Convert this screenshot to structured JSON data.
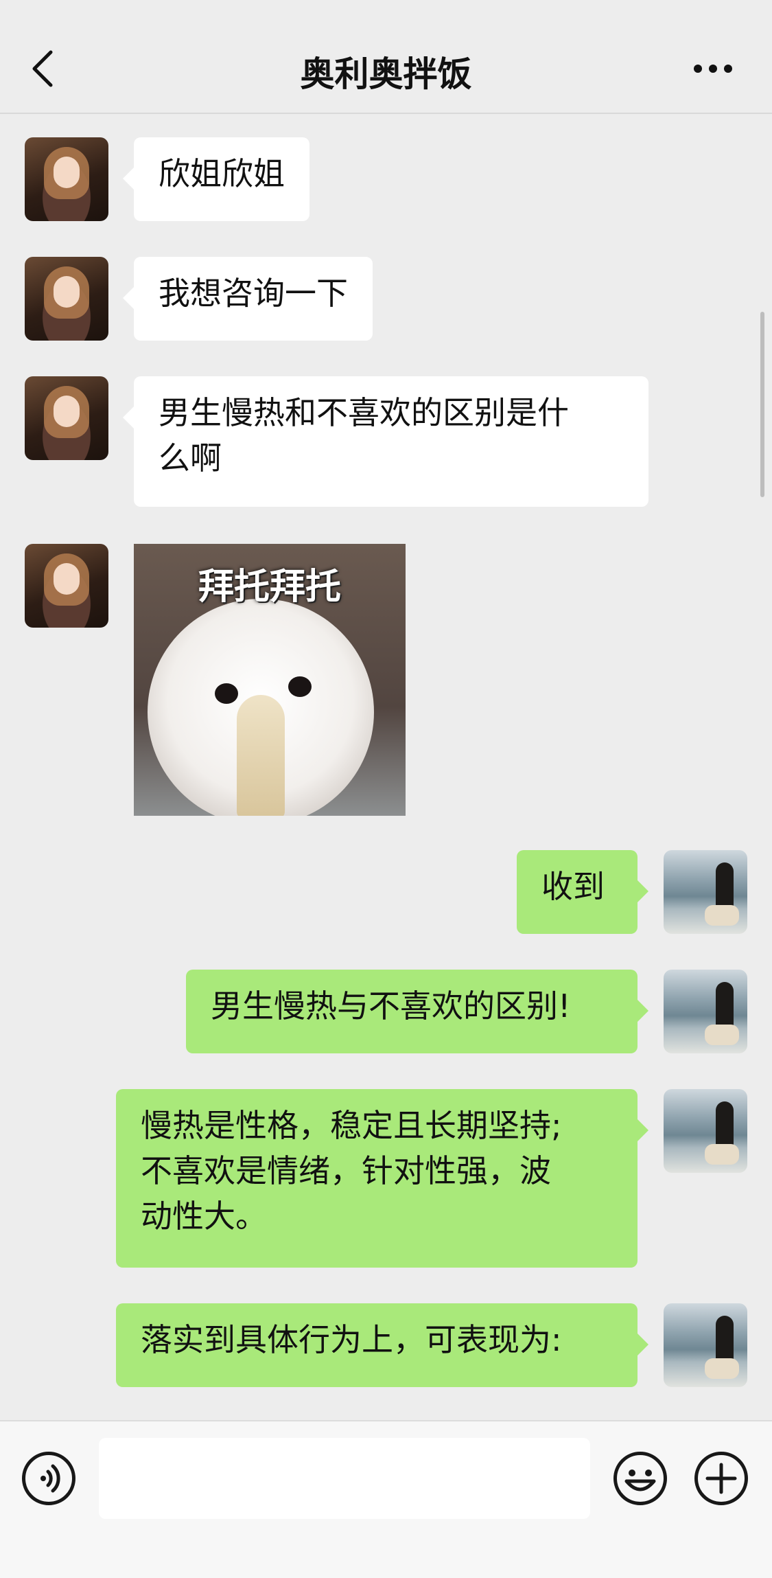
{
  "header": {
    "title": "奥利奥拌饭",
    "back_icon": "chevron-left-icon",
    "more_icon": "more-dots-icon"
  },
  "messages": [
    {
      "side": "in",
      "type": "text",
      "text": "欣姐欣姐"
    },
    {
      "side": "in",
      "type": "text",
      "text": "我想咨询一下"
    },
    {
      "side": "in",
      "type": "text",
      "lines": [
        "男生慢热和不喜欢的区别是什",
        "么啊"
      ]
    },
    {
      "side": "in",
      "type": "sticker",
      "caption": "拜托拜托"
    },
    {
      "side": "out",
      "type": "text",
      "text": "收到"
    },
    {
      "side": "out",
      "type": "text",
      "text": "男生慢热与不喜欢的区别!"
    },
    {
      "side": "out",
      "type": "text",
      "lines": [
        "慢热是性格，稳定且长期坚持;",
        "不喜欢是情绪，针对性强，波",
        "动性大。"
      ]
    },
    {
      "side": "out",
      "type": "text",
      "text": "落实到具体行为上，可表现为:"
    }
  ],
  "input_bar": {
    "voice_icon": "voice-icon",
    "emoji_icon": "emoji-icon",
    "plus_icon": "plus-icon",
    "text_value": ""
  },
  "colors": {
    "background": "#ededed",
    "incoming_bubble": "#ffffff",
    "outgoing_bubble": "#a9e97a"
  }
}
